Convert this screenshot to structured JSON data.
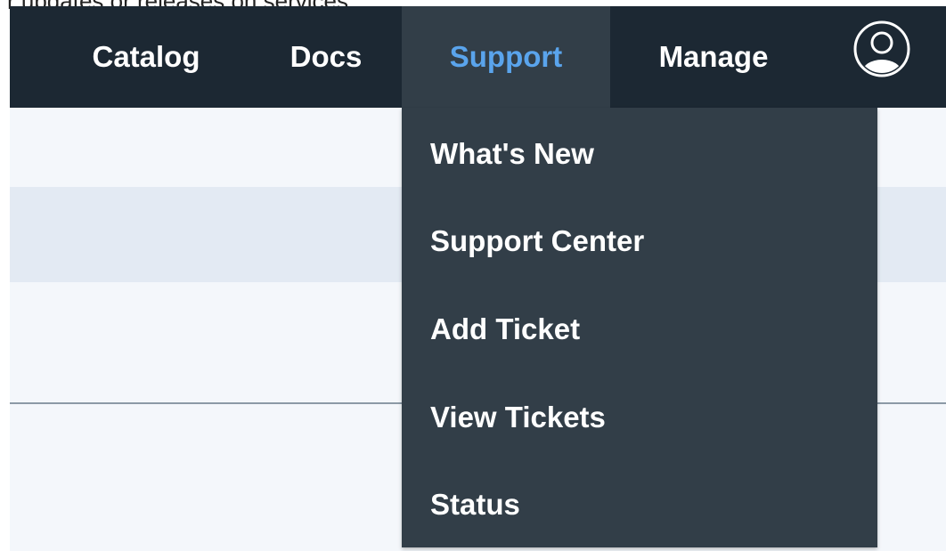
{
  "caption": "r updates or releases on services.",
  "nav": {
    "items": [
      {
        "label": "Catalog"
      },
      {
        "label": "Docs"
      },
      {
        "label": "Support"
      },
      {
        "label": "Manage"
      }
    ],
    "active": "Support",
    "active_color": "#5aa4ec",
    "avatar_icon": "user-circle-icon"
  },
  "support_menu": {
    "items": [
      {
        "label": "What's New"
      },
      {
        "label": "Support Center"
      },
      {
        "label": "Add Ticket"
      },
      {
        "label": "View Tickets"
      },
      {
        "label": "Status"
      }
    ]
  },
  "colors": {
    "navbar": "#1c2833",
    "dropdown": "#323e48",
    "content": "#f4f7fb",
    "highlight_row": "#e3eaf3"
  }
}
